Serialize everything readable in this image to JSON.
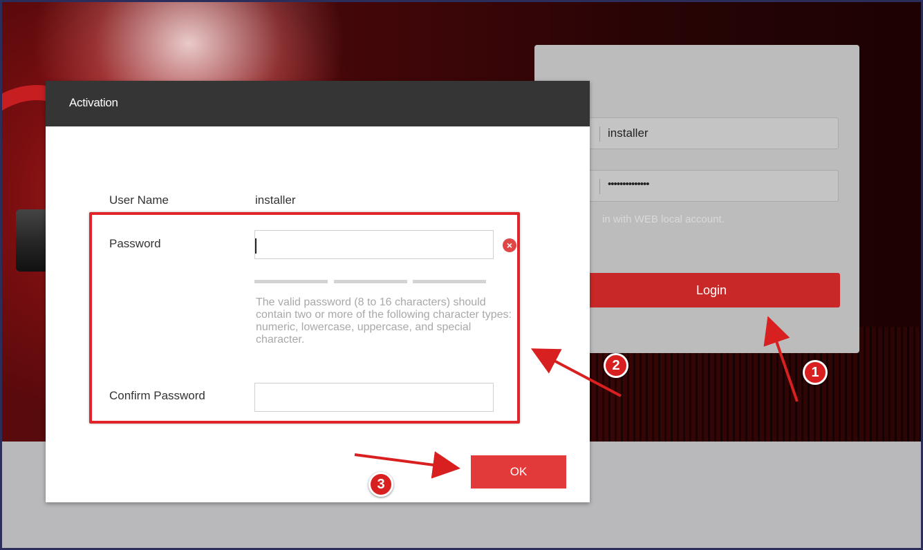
{
  "login": {
    "username_value": "installer",
    "password_masked": "••••••••••••••",
    "note": "in with WEB local account.",
    "login_label": "Login"
  },
  "dialog": {
    "title": "Activation",
    "username_label": "User Name",
    "username_value": "installer",
    "password_label": "Password",
    "password_value": "",
    "hint": "The valid password (8 to 16 characters) should contain two or more of the following character types: numeric, lowercase, uppercase, and special character.",
    "confirm_label": "Confirm Password",
    "confirm_value": "",
    "ok_label": "OK",
    "clear_glyph": "×"
  },
  "annotations": {
    "step1": "1",
    "step2": "2",
    "step3": "3"
  },
  "colors": {
    "accent_red": "#e23a3a",
    "header_dark": "#353535",
    "annotation_red": "#e0242a"
  }
}
